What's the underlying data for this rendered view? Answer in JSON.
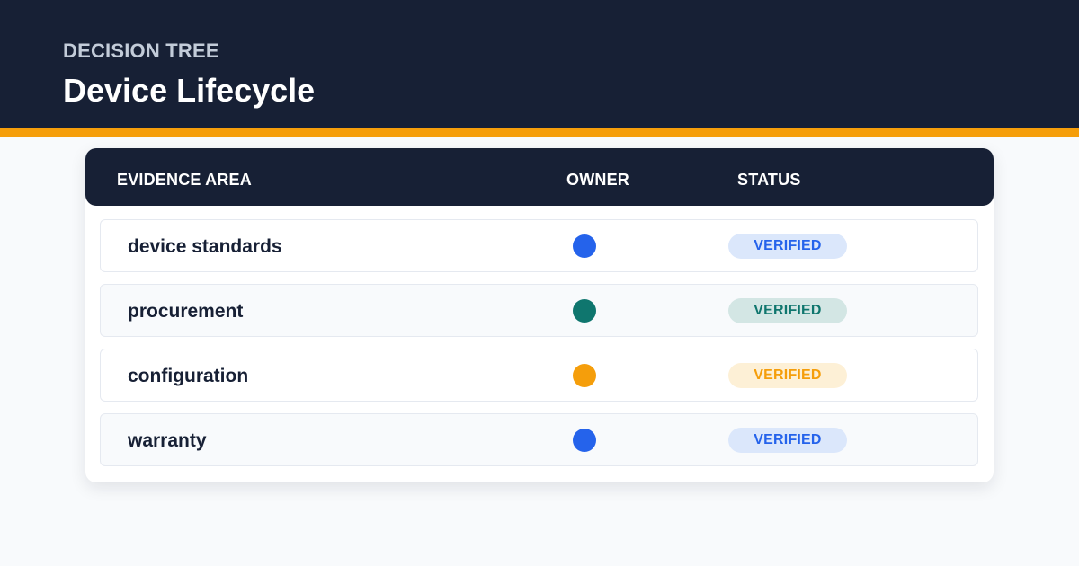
{
  "header": {
    "eyebrow": "DECISION TREE",
    "title": "Device Lifecycle"
  },
  "table": {
    "columns": {
      "area": "EVIDENCE AREA",
      "owner": "OWNER",
      "status": "STATUS"
    },
    "rows": [
      {
        "area": "device standards",
        "owner_color": "#2563eb",
        "status": "VERIFIED",
        "status_bg": "#dbe7fb",
        "status_fg": "#2563eb"
      },
      {
        "area": "procurement",
        "owner_color": "#0f766e",
        "status": "VERIFIED",
        "status_bg": "#d3e6e4",
        "status_fg": "#0f766e"
      },
      {
        "area": "configuration",
        "owner_color": "#f59e0b",
        "status": "VERIFIED",
        "status_bg": "#fdf0d6",
        "status_fg": "#f59e0b"
      },
      {
        "area": "warranty",
        "owner_color": "#2563eb",
        "status": "VERIFIED",
        "status_bg": "#dbe7fb",
        "status_fg": "#2563eb"
      }
    ]
  },
  "colors": {
    "header_bg": "#172035",
    "accent": "#f59e0b"
  }
}
